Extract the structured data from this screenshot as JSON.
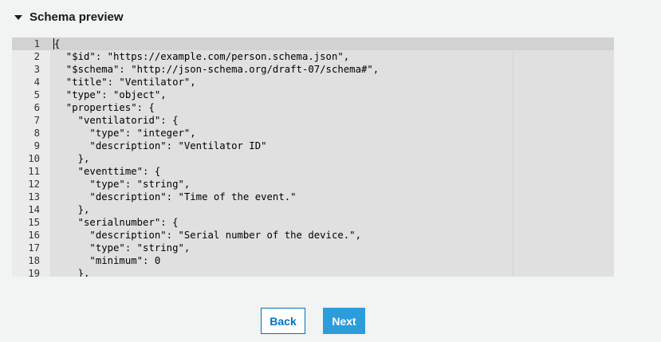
{
  "section": {
    "title": "Schema preview",
    "expanded": true,
    "icon": "caret-down-icon"
  },
  "editor": {
    "lines": [
      {
        "num": "1",
        "text": "{"
      },
      {
        "num": "2",
        "text": "  \"$id\": \"https://example.com/person.schema.json\","
      },
      {
        "num": "3",
        "text": "  \"$schema\": \"http://json-schema.org/draft-07/schema#\","
      },
      {
        "num": "4",
        "text": "  \"title\": \"Ventilator\","
      },
      {
        "num": "5",
        "text": "  \"type\": \"object\","
      },
      {
        "num": "6",
        "text": "  \"properties\": {"
      },
      {
        "num": "7",
        "text": "    \"ventilatorid\": {"
      },
      {
        "num": "8",
        "text": "      \"type\": \"integer\","
      },
      {
        "num": "9",
        "text": "      \"description\": \"Ventilator ID\""
      },
      {
        "num": "10",
        "text": "    },"
      },
      {
        "num": "11",
        "text": "    \"eventtime\": {"
      },
      {
        "num": "12",
        "text": "      \"type\": \"string\","
      },
      {
        "num": "13",
        "text": "      \"description\": \"Time of the event.\""
      },
      {
        "num": "14",
        "text": "    },"
      },
      {
        "num": "15",
        "text": "    \"serialnumber\": {"
      },
      {
        "num": "16",
        "text": "      \"description\": \"Serial number of the device.\","
      },
      {
        "num": "17",
        "text": "      \"type\": \"string\","
      },
      {
        "num": "18",
        "text": "      \"minimum\": 0"
      },
      {
        "num": "19",
        "text": "    },"
      }
    ]
  },
  "buttons": {
    "back_label": "Back",
    "next_label": "Next"
  },
  "colors": {
    "primary": "#2d9cdb",
    "link": "#0073bb",
    "editor_bg": "#e0e0e0",
    "page_bg": "#f2f3f3"
  }
}
